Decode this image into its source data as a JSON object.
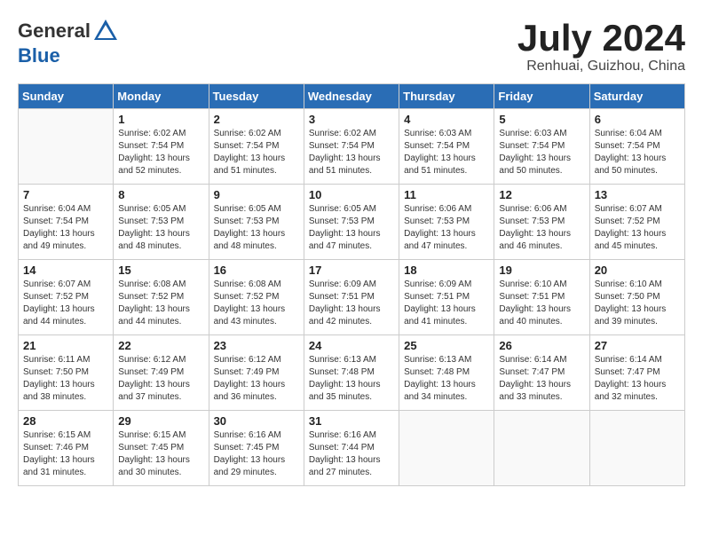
{
  "header": {
    "logo_general": "General",
    "logo_blue": "Blue",
    "month_title": "July 2024",
    "location": "Renhuai, Guizhou, China"
  },
  "calendar": {
    "days_of_week": [
      "Sunday",
      "Monday",
      "Tuesday",
      "Wednesday",
      "Thursday",
      "Friday",
      "Saturday"
    ],
    "weeks": [
      [
        {
          "day": "",
          "info": ""
        },
        {
          "day": "1",
          "info": "Sunrise: 6:02 AM\nSunset: 7:54 PM\nDaylight: 13 hours\nand 52 minutes."
        },
        {
          "day": "2",
          "info": "Sunrise: 6:02 AM\nSunset: 7:54 PM\nDaylight: 13 hours\nand 51 minutes."
        },
        {
          "day": "3",
          "info": "Sunrise: 6:02 AM\nSunset: 7:54 PM\nDaylight: 13 hours\nand 51 minutes."
        },
        {
          "day": "4",
          "info": "Sunrise: 6:03 AM\nSunset: 7:54 PM\nDaylight: 13 hours\nand 51 minutes."
        },
        {
          "day": "5",
          "info": "Sunrise: 6:03 AM\nSunset: 7:54 PM\nDaylight: 13 hours\nand 50 minutes."
        },
        {
          "day": "6",
          "info": "Sunrise: 6:04 AM\nSunset: 7:54 PM\nDaylight: 13 hours\nand 50 minutes."
        }
      ],
      [
        {
          "day": "7",
          "info": "Sunrise: 6:04 AM\nSunset: 7:54 PM\nDaylight: 13 hours\nand 49 minutes."
        },
        {
          "day": "8",
          "info": "Sunrise: 6:05 AM\nSunset: 7:53 PM\nDaylight: 13 hours\nand 48 minutes."
        },
        {
          "day": "9",
          "info": "Sunrise: 6:05 AM\nSunset: 7:53 PM\nDaylight: 13 hours\nand 48 minutes."
        },
        {
          "day": "10",
          "info": "Sunrise: 6:05 AM\nSunset: 7:53 PM\nDaylight: 13 hours\nand 47 minutes."
        },
        {
          "day": "11",
          "info": "Sunrise: 6:06 AM\nSunset: 7:53 PM\nDaylight: 13 hours\nand 47 minutes."
        },
        {
          "day": "12",
          "info": "Sunrise: 6:06 AM\nSunset: 7:53 PM\nDaylight: 13 hours\nand 46 minutes."
        },
        {
          "day": "13",
          "info": "Sunrise: 6:07 AM\nSunset: 7:52 PM\nDaylight: 13 hours\nand 45 minutes."
        }
      ],
      [
        {
          "day": "14",
          "info": "Sunrise: 6:07 AM\nSunset: 7:52 PM\nDaylight: 13 hours\nand 44 minutes."
        },
        {
          "day": "15",
          "info": "Sunrise: 6:08 AM\nSunset: 7:52 PM\nDaylight: 13 hours\nand 44 minutes."
        },
        {
          "day": "16",
          "info": "Sunrise: 6:08 AM\nSunset: 7:52 PM\nDaylight: 13 hours\nand 43 minutes."
        },
        {
          "day": "17",
          "info": "Sunrise: 6:09 AM\nSunset: 7:51 PM\nDaylight: 13 hours\nand 42 minutes."
        },
        {
          "day": "18",
          "info": "Sunrise: 6:09 AM\nSunset: 7:51 PM\nDaylight: 13 hours\nand 41 minutes."
        },
        {
          "day": "19",
          "info": "Sunrise: 6:10 AM\nSunset: 7:51 PM\nDaylight: 13 hours\nand 40 minutes."
        },
        {
          "day": "20",
          "info": "Sunrise: 6:10 AM\nSunset: 7:50 PM\nDaylight: 13 hours\nand 39 minutes."
        }
      ],
      [
        {
          "day": "21",
          "info": "Sunrise: 6:11 AM\nSunset: 7:50 PM\nDaylight: 13 hours\nand 38 minutes."
        },
        {
          "day": "22",
          "info": "Sunrise: 6:12 AM\nSunset: 7:49 PM\nDaylight: 13 hours\nand 37 minutes."
        },
        {
          "day": "23",
          "info": "Sunrise: 6:12 AM\nSunset: 7:49 PM\nDaylight: 13 hours\nand 36 minutes."
        },
        {
          "day": "24",
          "info": "Sunrise: 6:13 AM\nSunset: 7:48 PM\nDaylight: 13 hours\nand 35 minutes."
        },
        {
          "day": "25",
          "info": "Sunrise: 6:13 AM\nSunset: 7:48 PM\nDaylight: 13 hours\nand 34 minutes."
        },
        {
          "day": "26",
          "info": "Sunrise: 6:14 AM\nSunset: 7:47 PM\nDaylight: 13 hours\nand 33 minutes."
        },
        {
          "day": "27",
          "info": "Sunrise: 6:14 AM\nSunset: 7:47 PM\nDaylight: 13 hours\nand 32 minutes."
        }
      ],
      [
        {
          "day": "28",
          "info": "Sunrise: 6:15 AM\nSunset: 7:46 PM\nDaylight: 13 hours\nand 31 minutes."
        },
        {
          "day": "29",
          "info": "Sunrise: 6:15 AM\nSunset: 7:45 PM\nDaylight: 13 hours\nand 30 minutes."
        },
        {
          "day": "30",
          "info": "Sunrise: 6:16 AM\nSunset: 7:45 PM\nDaylight: 13 hours\nand 29 minutes."
        },
        {
          "day": "31",
          "info": "Sunrise: 6:16 AM\nSunset: 7:44 PM\nDaylight: 13 hours\nand 27 minutes."
        },
        {
          "day": "",
          "info": ""
        },
        {
          "day": "",
          "info": ""
        },
        {
          "day": "",
          "info": ""
        }
      ]
    ]
  }
}
